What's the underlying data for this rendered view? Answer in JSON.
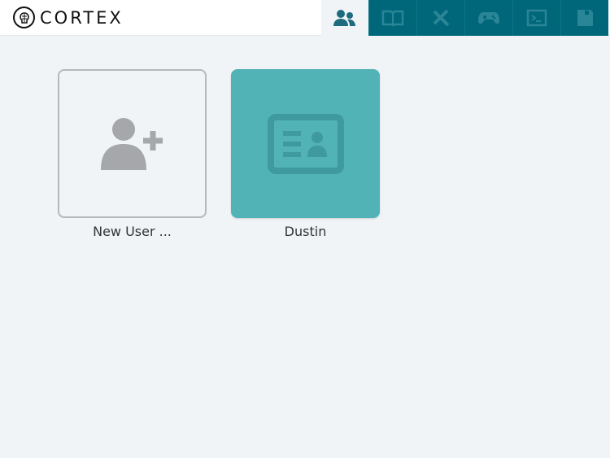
{
  "header": {
    "logo_text": "CORTEX"
  },
  "tabs": [
    {
      "name": "users",
      "icon": "users-icon",
      "active": true
    },
    {
      "name": "library",
      "icon": "book-icon",
      "active": false
    },
    {
      "name": "tools",
      "icon": "tools-icon",
      "active": false
    },
    {
      "name": "games",
      "icon": "gamepad-icon",
      "active": false
    },
    {
      "name": "terminal",
      "icon": "terminal-icon",
      "active": false
    },
    {
      "name": "save",
      "icon": "floppy-icon",
      "active": false
    }
  ],
  "profiles": [
    {
      "label": "New User ..."
    },
    {
      "label": "Dustin"
    }
  ],
  "colors": {
    "tab_bar": "#00677a",
    "tab_icon": "#2a8596",
    "active_icon": "#1d6b7c",
    "profile_card": "#52b3b6"
  }
}
